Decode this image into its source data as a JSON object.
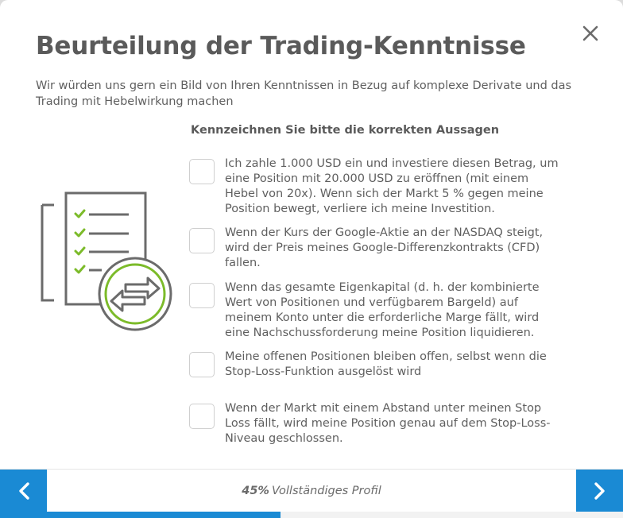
{
  "dialog": {
    "title": "Beurteilung der Trading-Kenntnisse",
    "subtitle": "Wir würden uns gern ein Bild von Ihren Kenntnissen in Bezug auf komplexe Derivate und das Trading mit Hebelwirkung machen",
    "close_icon": "close-icon"
  },
  "question": {
    "prompt": "Kennzeichnen Sie bitte die korrekten Aussagen",
    "options": [
      {
        "label": "Ich zahle 1.000 USD ein und investiere diesen Betrag, um eine Position mit 20.000 USD zu eröffnen (mit einem Hebel von 20x). Wenn sich der Markt 5 % gegen meine Position bewegt, verliere ich meine Investition.",
        "checked": false
      },
      {
        "label": "Wenn der Kurs der Google-Aktie an der NASDAQ steigt, wird der Preis meines Google-Differenzkontrakts (CFD) fallen.",
        "checked": false
      },
      {
        "label": "Wenn das gesamte Eigenkapital (d. h. der kombinierte Wert von Positionen und verfügbarem Bargeld) auf meinem Konto unter die erforderliche Marge fällt, wird eine Nachschussforderung meine Position liquidieren.",
        "checked": false
      },
      {
        "label": "Meine offenen Positionen bleiben offen, selbst wenn die Stop-Loss-Funktion ausgelöst wird",
        "checked": false
      },
      {
        "label": "Wenn der Markt mit einem Abstand unter meinen Stop Loss fällt, wird meine Position genau auf dem Stop-Loss-Niveau geschlossen.",
        "checked": false
      }
    ]
  },
  "footer": {
    "progress_percent": "45%",
    "progress_value": 0.45,
    "progress_label": "Vollständiges Profil",
    "prev_icon": "chevron-left-icon",
    "next_icon": "chevron-right-icon"
  },
  "colors": {
    "accent": "#1a8ad4",
    "check_green": "#7cbb2a",
    "title": "#5a5a5a",
    "text": "#5f5f5f"
  }
}
